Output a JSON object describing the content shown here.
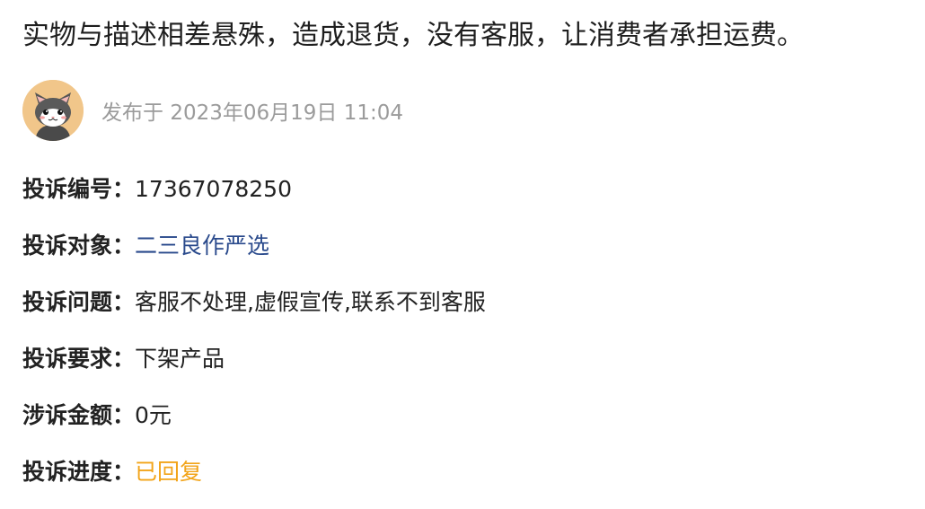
{
  "complaint": {
    "title": "实物与描述相差悬殊，造成退货，没有客服，让消费者承担运费。",
    "published_prefix": "发布于",
    "published_time": "2023年06月19日 11:04",
    "avatar_icon": "cat-avatar-icon"
  },
  "fields": [
    {
      "label": "投诉编号：",
      "value": "17367078250"
    },
    {
      "label": "投诉对象：",
      "value": "二三良作严选"
    },
    {
      "label": "投诉问题：",
      "value": "客服不处理,虚假宣传,联系不到客服"
    },
    {
      "label": "投诉要求：",
      "value": "下架产品"
    },
    {
      "label": "涉诉金额：",
      "value": "0元"
    },
    {
      "label": "投诉进度：",
      "value": "已回复"
    }
  ],
  "colors": {
    "link": "#2a4a8c",
    "status": "#f2a419",
    "muted": "#9b9b9b",
    "avatar_bg": "#f1c68a"
  }
}
